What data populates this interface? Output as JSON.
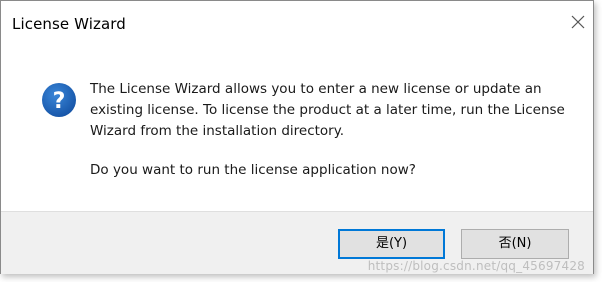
{
  "window": {
    "title": "License Wizard",
    "close_icon": "close-icon"
  },
  "message": {
    "icon": "question-icon",
    "icon_color": "#1e5fb4",
    "line1": "The License Wizard allows you to enter a new license or update an",
    "line2": "existing license. To license the product at a later time, run the License",
    "line3": "Wizard from the installation directory.",
    "question": "Do you want to run the license application now?"
  },
  "buttons": {
    "yes_label": "是(Y)",
    "no_label": "否(N)",
    "default_accent": "#0078d7"
  },
  "watermark": "https://blog.csdn.net/qq_45697428"
}
